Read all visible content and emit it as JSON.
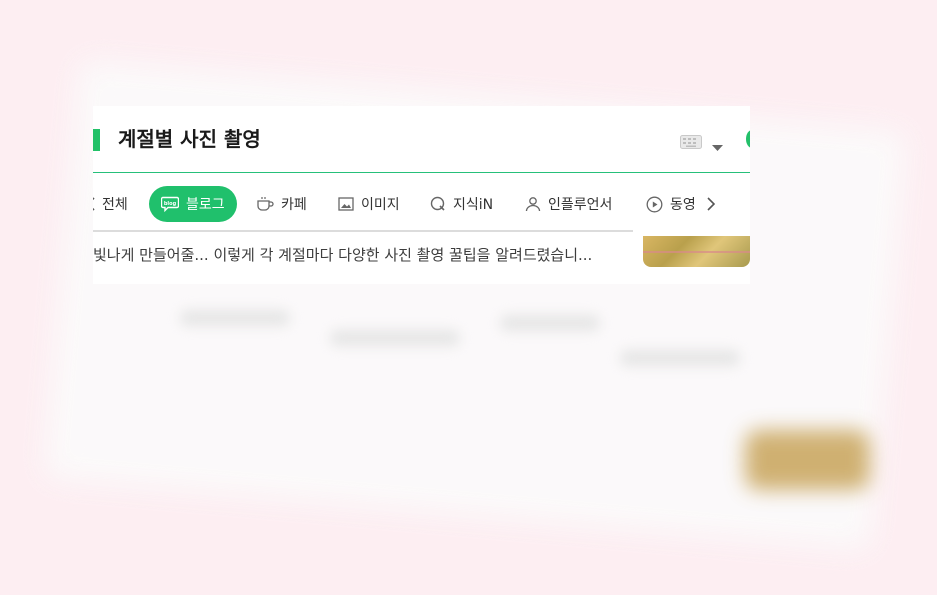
{
  "header": {
    "title": "계절별 사진 촬영"
  },
  "tabs": [
    {
      "label": "전체",
      "icon": "search-icon",
      "active": false
    },
    {
      "label": "블로그",
      "icon": "blog-icon",
      "active": true
    },
    {
      "label": "카페",
      "icon": "cup-icon",
      "active": false
    },
    {
      "label": "이미지",
      "icon": "image-icon",
      "active": false
    },
    {
      "label": "지식iN",
      "icon": "q-icon",
      "active": false
    },
    {
      "label": "인플루언서",
      "icon": "person-icon",
      "active": false
    },
    {
      "label": "동영",
      "icon": "play-icon",
      "active": false
    }
  ],
  "result": {
    "snippet": "빛나게 만들어줄... 이렇게 각 계절마다 다양한 사진 촬영 꿀팁을 알려드렸습니..."
  },
  "colors": {
    "accent": "#20c06c",
    "background": "#fdeef2"
  }
}
